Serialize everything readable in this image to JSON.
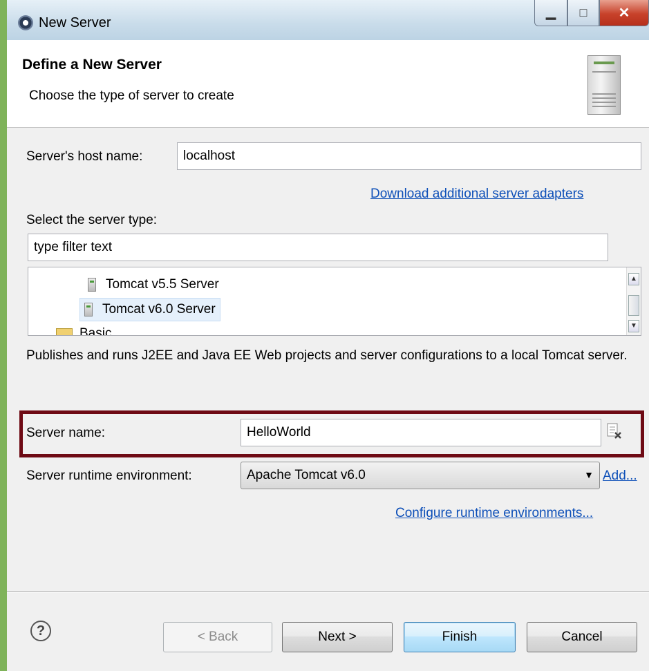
{
  "window": {
    "title": "New Server",
    "controls": {
      "minimize": "▁",
      "maximize": "□",
      "close": "✕"
    }
  },
  "header": {
    "title": "Define a New Server",
    "subtitle": "Choose the type of server to create"
  },
  "host": {
    "label": "Server's host name:",
    "value": "localhost"
  },
  "download_link": "Download additional server adapters",
  "server_type": {
    "label": "Select the server type:",
    "filter_value": "type filter text",
    "items": [
      {
        "label": "Tomcat v5.5 Server",
        "selected": false
      },
      {
        "label": "Tomcat v6.0 Server",
        "selected": true
      }
    ],
    "folder_label": "Basic"
  },
  "description": "Publishes and runs J2EE and Java EE Web projects and server configurations to a local Tomcat server.",
  "server_name": {
    "label": "Server name:",
    "value": "HelloWorld"
  },
  "runtime": {
    "label": "Server runtime environment:",
    "value": "Apache Tomcat v6.0",
    "add_link": "Add..."
  },
  "configure_link": "Configure runtime environments...",
  "buttons": {
    "help": "?",
    "back": "< Back",
    "next": "Next >",
    "finish": "Finish",
    "cancel": "Cancel"
  },
  "colors": {
    "highlight_border": "#6e0a14",
    "link": "#0d4fb8"
  }
}
